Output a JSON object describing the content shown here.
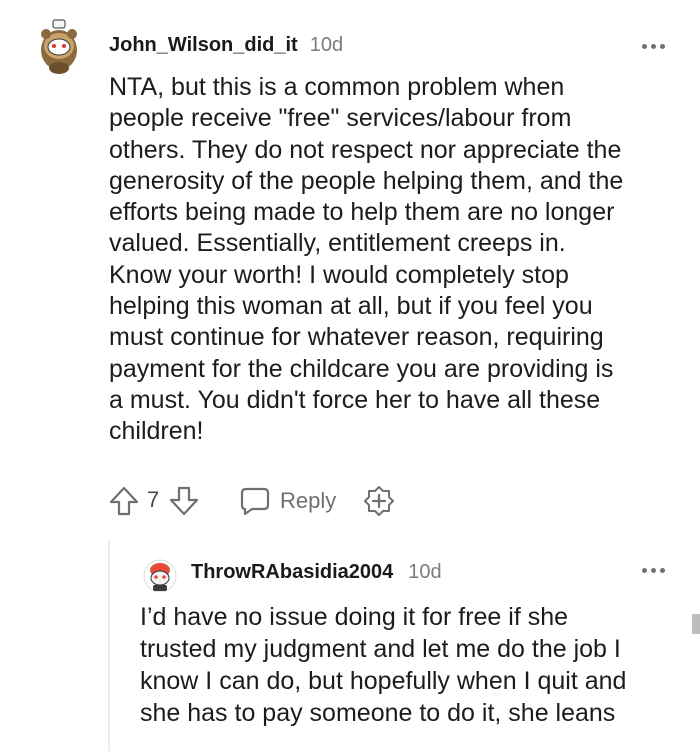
{
  "comment": {
    "username": "John_Wilson_did_it",
    "time": "10d",
    "body_lines": [
      "NTA, but this is a common problem when",
      "people receive \"free\" services/labour from",
      "others. They do not respect nor appreciate the",
      "generosity of the people helping them, and the",
      "efforts being made to help them are no longer",
      "valued. Essentially, entitlement creeps in.",
      "Know your worth! I would completely stop",
      "helping this woman at all, but if you feel you",
      "must continue for whatever reason, requiring",
      "payment for the childcare you are providing is",
      "a must. You didn't force her to have all these",
      "children!"
    ],
    "votes": "7",
    "reply_label": "Reply"
  },
  "reply": {
    "username": "ThrowRAbasidia2004",
    "time": "10d",
    "body_lines": [
      "I’d have no issue doing it for free if she",
      "trusted my judgment and let me do the job I",
      "know I can do, but hopefully when I quit and",
      "she has to pay someone to do it, she leans"
    ]
  },
  "colors": {
    "text": "#1c1c1c",
    "muted": "#7c7c7c",
    "icon": "#6f6f6f",
    "thread_line": "#ededed"
  },
  "icons": [
    "avatar-snoo-bear",
    "more-options-icon",
    "upvote-icon",
    "downvote-icon",
    "reply-bubble-icon",
    "award-plus-icon",
    "avatar-snoo-red"
  ]
}
